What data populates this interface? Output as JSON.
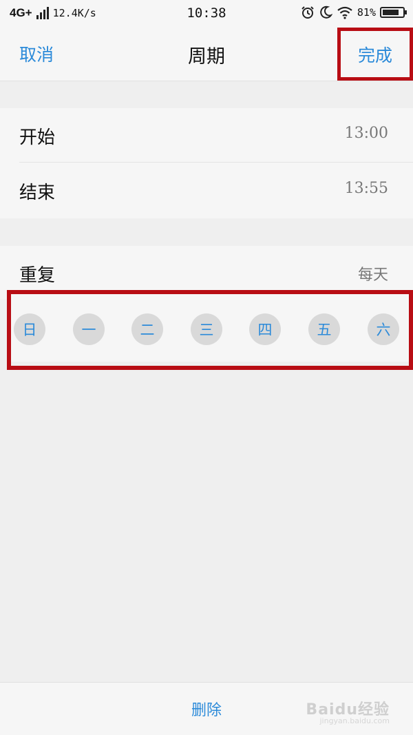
{
  "status_bar": {
    "network": "4G+",
    "speed": "12.4K/s",
    "time": "10:38",
    "battery_percent": "81%",
    "battery_level": 0.81,
    "icons": [
      "signal-icon",
      "alarm-icon",
      "moon-icon",
      "wifi-icon",
      "battery-icon"
    ]
  },
  "navbar": {
    "cancel_label": "取消",
    "title": "周期",
    "done_label": "完成"
  },
  "time_rows": [
    {
      "label": "开始",
      "value": "13:00"
    },
    {
      "label": "结束",
      "value": "13:55"
    }
  ],
  "repeat": {
    "label": "重复",
    "value": "每天",
    "days": [
      "日",
      "一",
      "二",
      "三",
      "四",
      "五",
      "六"
    ]
  },
  "bottom": {
    "delete_label": "删除"
  },
  "watermark": {
    "text": "Baidu经验",
    "sub": "jingyan.baidu.com"
  },
  "colors": {
    "accent": "#2b8ad9",
    "highlight_frame": "#b80d14",
    "day_circle": "#d9d9d9",
    "background": "#efefef"
  }
}
